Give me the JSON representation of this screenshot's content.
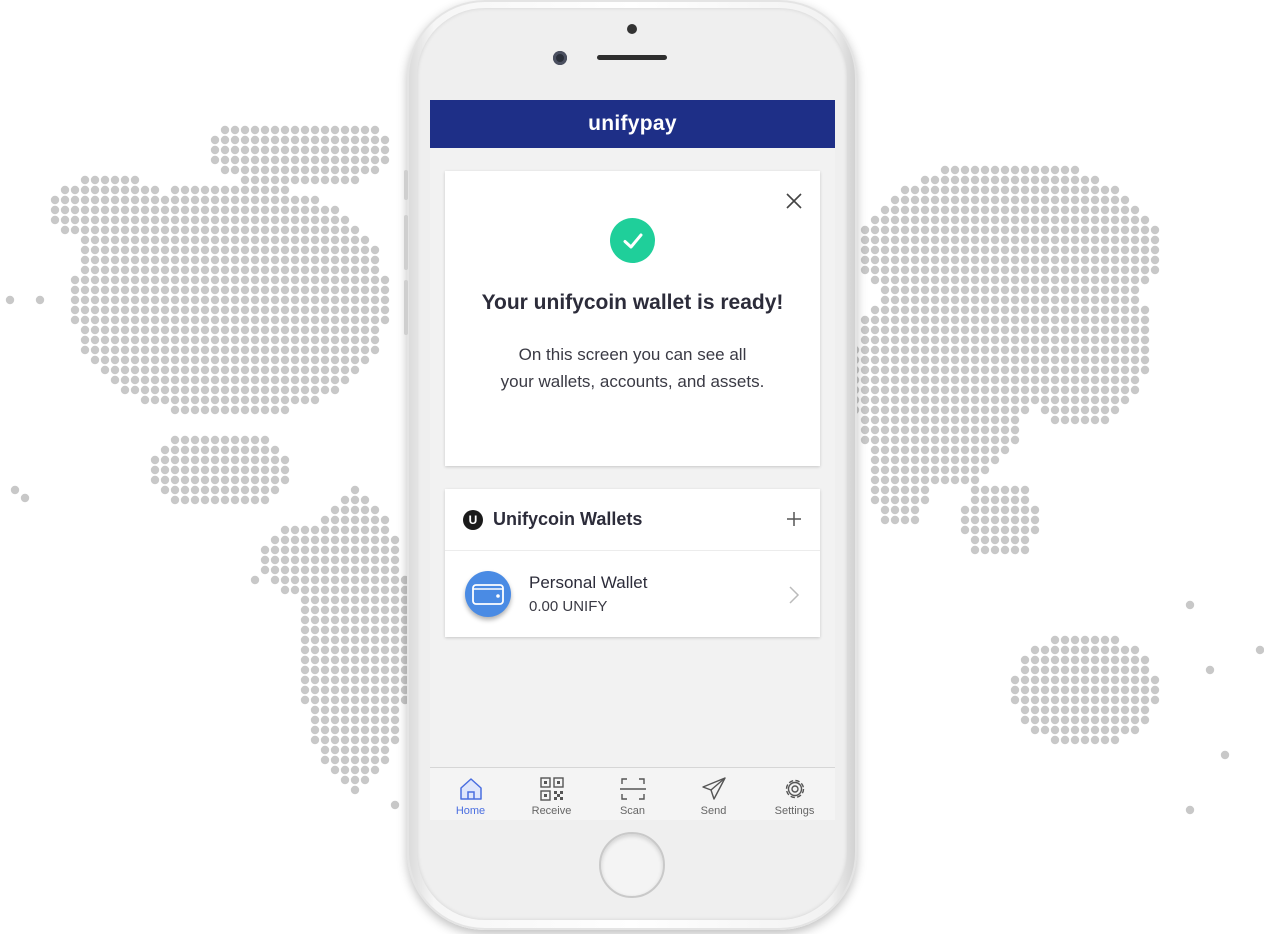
{
  "app": {
    "brand": "unifypay"
  },
  "welcome_card": {
    "title": "Your unifycoin wallet is ready!",
    "description": "On this screen you can see all your wallets, accounts, and assets.",
    "icon": "check-icon",
    "close_icon": "close-icon"
  },
  "wallets": {
    "section_title": "Unifycoin Wallets",
    "logo_glyph": "U",
    "add_icon": "plus-icon",
    "items": [
      {
        "name": "Personal Wallet",
        "balance": "0.00 UNIFY",
        "icon": "wallet-icon"
      }
    ]
  },
  "bottom_nav": [
    {
      "label": "Home",
      "icon": "home-icon",
      "active": true
    },
    {
      "label": "Receive",
      "icon": "qr-code-icon",
      "active": false
    },
    {
      "label": "Scan",
      "icon": "scan-icon",
      "active": false
    },
    {
      "label": "Send",
      "icon": "send-icon",
      "active": false
    },
    {
      "label": "Settings",
      "icon": "gear-icon",
      "active": false
    }
  ],
  "colors": {
    "header_bg": "#1e2f87",
    "success": "#1fcf9a",
    "wallet_blue": "#4a8be4",
    "nav_active": "#4a6ee0",
    "map_dot": "#c8c8c8"
  }
}
